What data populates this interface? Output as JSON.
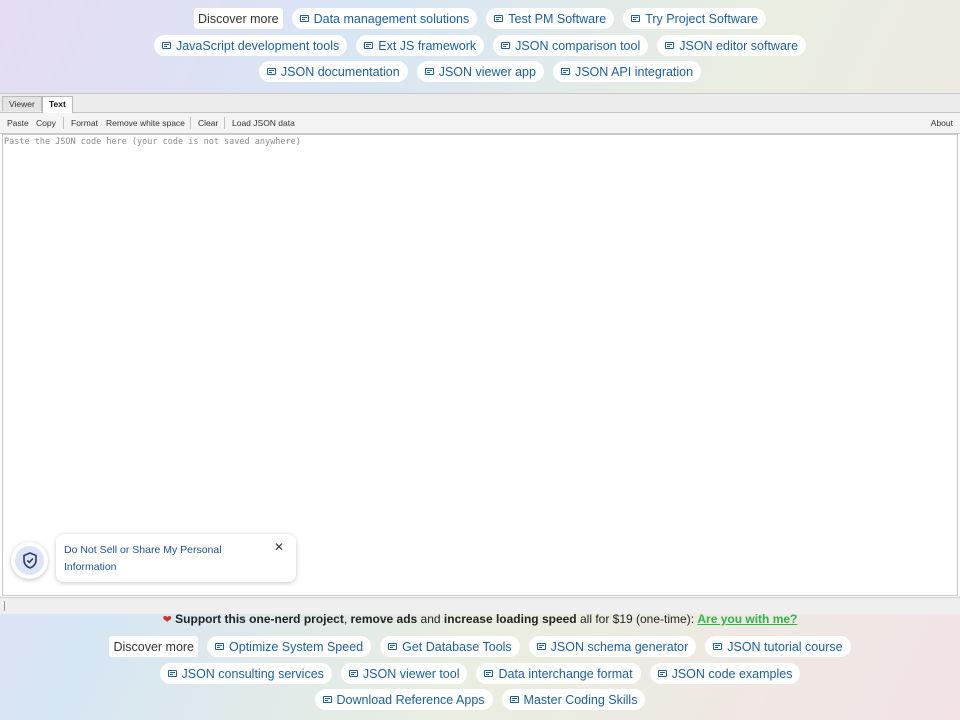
{
  "top_ads": {
    "row1": [
      "Discover more",
      "Data management solutions",
      "Test PM Software",
      "Try Project Software"
    ],
    "row2": [
      "JavaScript development tools",
      "Ext JS framework",
      "JSON comparison tool",
      "JSON editor software"
    ],
    "row3": [
      "JSON documentation",
      "JSON viewer app",
      "JSON API integration"
    ]
  },
  "tabs": {
    "viewer": "Viewer",
    "text": "Text"
  },
  "toolbar": {
    "paste": "Paste",
    "copy": "Copy",
    "format": "Format",
    "remove_ws": "Remove white space",
    "clear": "Clear",
    "load": "Load JSON data",
    "about": "About"
  },
  "editor": {
    "placeholder": "Paste the JSON code here (your code is not saved anywhere)",
    "value": ""
  },
  "privacy": {
    "text": "Do Not Sell or Share My Personal Information",
    "close": "✕"
  },
  "support": {
    "heart": "❤",
    "part1": "Support this one-nerd project",
    "comma": ", ",
    "part2": "remove ads",
    "and": " and ",
    "part3": "increase loading speed",
    "rest": " all for $19 (one-time): ",
    "link": "Are you with me?"
  },
  "bottom_ads": {
    "row1": [
      "Discover more",
      "Optimize System Speed",
      "Get Database Tools",
      "JSON schema generator",
      "JSON tutorial course"
    ],
    "row2": [
      "JSON consulting services",
      "JSON viewer tool",
      "Data interchange format",
      "JSON code examples"
    ],
    "row3": [
      "Download Reference Apps",
      "Master Coding Skills"
    ]
  },
  "colors": {
    "link": "#1a5fa6",
    "cta_link": "#2db34a",
    "heart": "#d0312d"
  }
}
